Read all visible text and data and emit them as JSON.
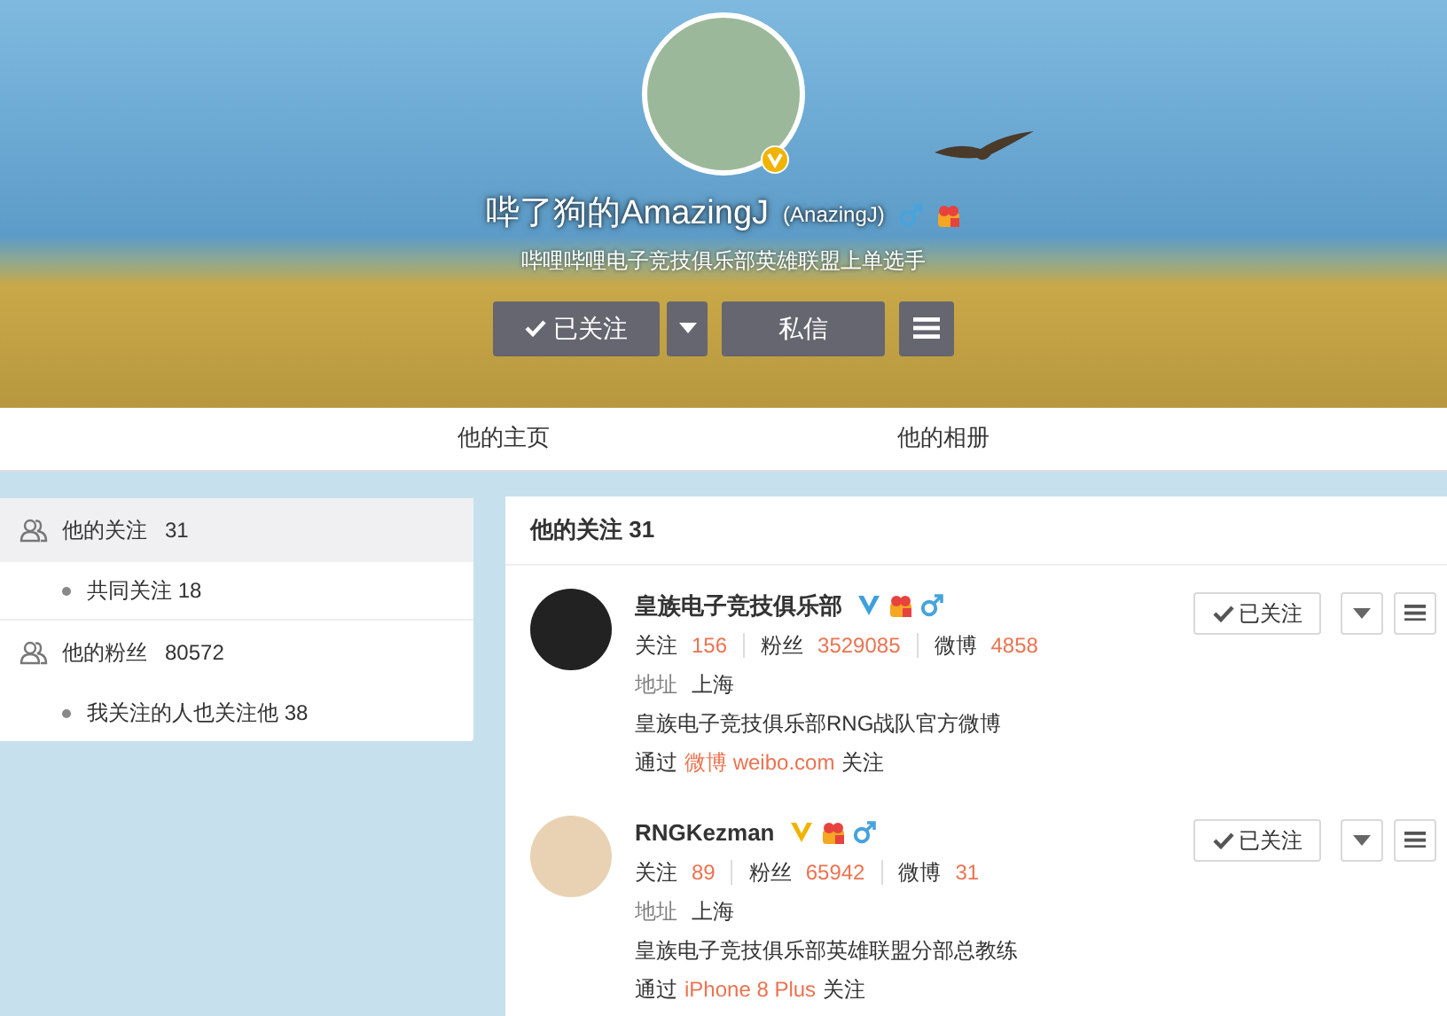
{
  "profile": {
    "name": "哔了狗的AmazingJ",
    "remark": "(AnazingJ)",
    "male": true,
    "bio": "哔哩哔哩电子竞技俱乐部英雄联盟上单选手",
    "buttons": [
      {
        "kind": "followed",
        "label": "已关注"
      },
      {
        "kind": "dropdown"
      },
      {
        "kind": "text",
        "label": "私信"
      },
      {
        "kind": "menu"
      }
    ]
  },
  "tabs": [
    {
      "label": "他的主页",
      "selected": false
    },
    {
      "label": "他的相册",
      "selected": false
    }
  ],
  "sidebar": {
    "items": [
      {
        "label": "他的关注",
        "count": "31",
        "selected": true,
        "children": [
          {
            "label": "共同关注 18"
          }
        ]
      },
      {
        "label": "他的粉丝",
        "count": "80572",
        "selected": false,
        "children": [
          {
            "label": "我关注的人也关注他 38"
          }
        ]
      }
    ]
  },
  "following": {
    "title": "他的关注 31",
    "users": [
      {
        "name": "皇族电子竞技俱乐部",
        "verified_badge": {
          "color": "#3ca0dc"
        },
        "male": true,
        "stats": [
          {
            "label": "关注",
            "value": "156"
          },
          {
            "label": "粉丝",
            "value": "3529085"
          },
          {
            "label": "微博",
            "value": "4858"
          }
        ],
        "address_label": "地址",
        "address": "上海",
        "bio": "皇族电子竞技俱乐部RNG战队官方微博",
        "via": {
          "prefix": "通过",
          "source": "微博 weibo.com",
          "suffix": "关注"
        },
        "follow_label": "已关注"
      },
      {
        "name": "RNGKezman",
        "verified_badge": {
          "color": "#f0b400"
        },
        "male": true,
        "stats": [
          {
            "label": "关注",
            "value": "89"
          },
          {
            "label": "粉丝",
            "value": "65942"
          },
          {
            "label": "微博",
            "value": "31"
          }
        ],
        "address_label": "地址",
        "address": "上海",
        "bio": "皇族电子竞技俱乐部英雄联盟分部总教练",
        "via": {
          "prefix": "通过",
          "source": "iPhone 8 Plus",
          "suffix": "关注"
        },
        "follow_label": "已关注"
      }
    ]
  }
}
